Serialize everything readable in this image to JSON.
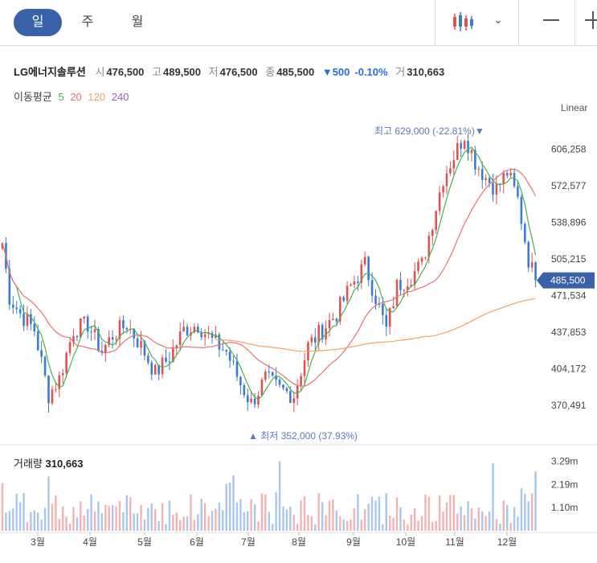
{
  "tabs": [
    {
      "label": "일"
    },
    {
      "label": "주"
    },
    {
      "label": "월"
    }
  ],
  "header": {
    "name": "LG에너지솔루션",
    "open_label": "시",
    "open": "476,500",
    "high_label": "고",
    "high": "489,500",
    "low_label": "저",
    "low": "476,500",
    "close_label": "종",
    "close": "485,500",
    "change": "▼500",
    "change_pct": "-0.10%",
    "volume_label": "거",
    "volume": "310,663"
  },
  "ma": {
    "label": "이동평균",
    "p5": "5",
    "p20": "20",
    "p120": "120",
    "p240": "240"
  },
  "scale": "Linear",
  "volume_panel": {
    "label": "거래량",
    "value": "310,663"
  },
  "colors": {
    "up": "#e05252",
    "down": "#3a7bd5",
    "ma5": "#4caf50",
    "ma20": "#e57373",
    "ma120": "#f4a261",
    "ma240": "#8e63c7",
    "accent": "#3a62a8"
  },
  "chart_data": {
    "type": "candlestick",
    "y_ticks": [
      "606,258",
      "572,577",
      "538,896",
      "505,215",
      "471,534",
      "437,853",
      "404,172",
      "370,491"
    ],
    "y_tick_values": [
      606258,
      572577,
      538896,
      505215,
      471534,
      437853,
      404172,
      370491
    ],
    "ylim": [
      340000,
      640000
    ],
    "x_ticks": [
      "3월",
      "4월",
      "5월",
      "6월",
      "7월",
      "8월",
      "9월",
      "10월",
      "11월",
      "12월"
    ],
    "current_price_label": "485,500",
    "current_price": 485500,
    "max_annotation": "최고 629,000 (-22.81%)▼",
    "min_annotation": "▲ 최저 352,000 (37.93%)",
    "vol_ticks": [
      "3.29m",
      "2.19m",
      "1.10m"
    ],
    "vol_tick_values": [
      3290000,
      2190000,
      1100000
    ],
    "vol_max": 3800000,
    "close_path": [
      [
        0,
        520000
      ],
      [
        2,
        470000
      ],
      [
        5,
        455000
      ],
      [
        9,
        440000
      ],
      [
        13,
        380000
      ],
      [
        16,
        395000
      ],
      [
        20,
        440000
      ],
      [
        24,
        445000
      ],
      [
        28,
        420000
      ],
      [
        31,
        435000
      ],
      [
        35,
        445000
      ],
      [
        39,
        425000
      ],
      [
        43,
        400000
      ],
      [
        47,
        415000
      ],
      [
        51,
        440000
      ],
      [
        55,
        445000
      ],
      [
        59,
        430000
      ],
      [
        63,
        420000
      ],
      [
        67,
        390000
      ],
      [
        70,
        372000
      ],
      [
        74,
        395000
      ],
      [
        78,
        385000
      ],
      [
        82,
        380000
      ],
      [
        86,
        425000
      ],
      [
        90,
        440000
      ],
      [
        94,
        455000
      ],
      [
        98,
        480000
      ],
      [
        102,
        500000
      ],
      [
        105,
        470000
      ],
      [
        108,
        440000
      ],
      [
        111,
        480000
      ],
      [
        115,
        490000
      ],
      [
        118,
        500000
      ],
      [
        121,
        540000
      ],
      [
        124,
        580000
      ],
      [
        127,
        600000
      ],
      [
        130,
        620000
      ],
      [
        133,
        595000
      ],
      [
        136,
        580000
      ],
      [
        139,
        570000
      ],
      [
        142,
        585000
      ],
      [
        145,
        560000
      ],
      [
        148,
        505000
      ],
      [
        150,
        485500
      ]
    ]
  }
}
